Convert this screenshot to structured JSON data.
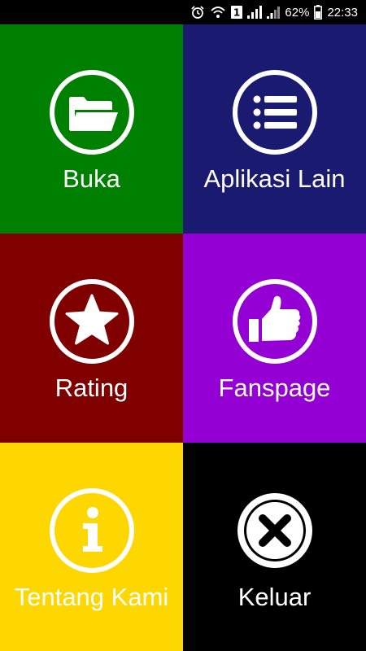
{
  "status_bar": {
    "battery_percent": "62%",
    "time": "22:33",
    "sim_badge": "1",
    "icons": [
      "alarm-icon",
      "wifi-icon",
      "sim-badge-icon",
      "signal-icon",
      "signal-icon-2",
      "battery-icon"
    ]
  },
  "menu": {
    "tiles": [
      {
        "label": "Buka",
        "icon": "folder-icon",
        "color": "#008000"
      },
      {
        "label": "Aplikasi Lain",
        "icon": "list-icon",
        "color": "#1a1a70"
      },
      {
        "label": "Rating",
        "icon": "star-icon",
        "color": "#800000"
      },
      {
        "label": "Fanspage",
        "icon": "thumbs-up-icon",
        "color": "#9400d3"
      },
      {
        "label": "Tentang Kami",
        "icon": "info-icon",
        "color": "#ffd700"
      },
      {
        "label": "Keluar",
        "icon": "close-icon",
        "color": "#000000"
      }
    ]
  }
}
